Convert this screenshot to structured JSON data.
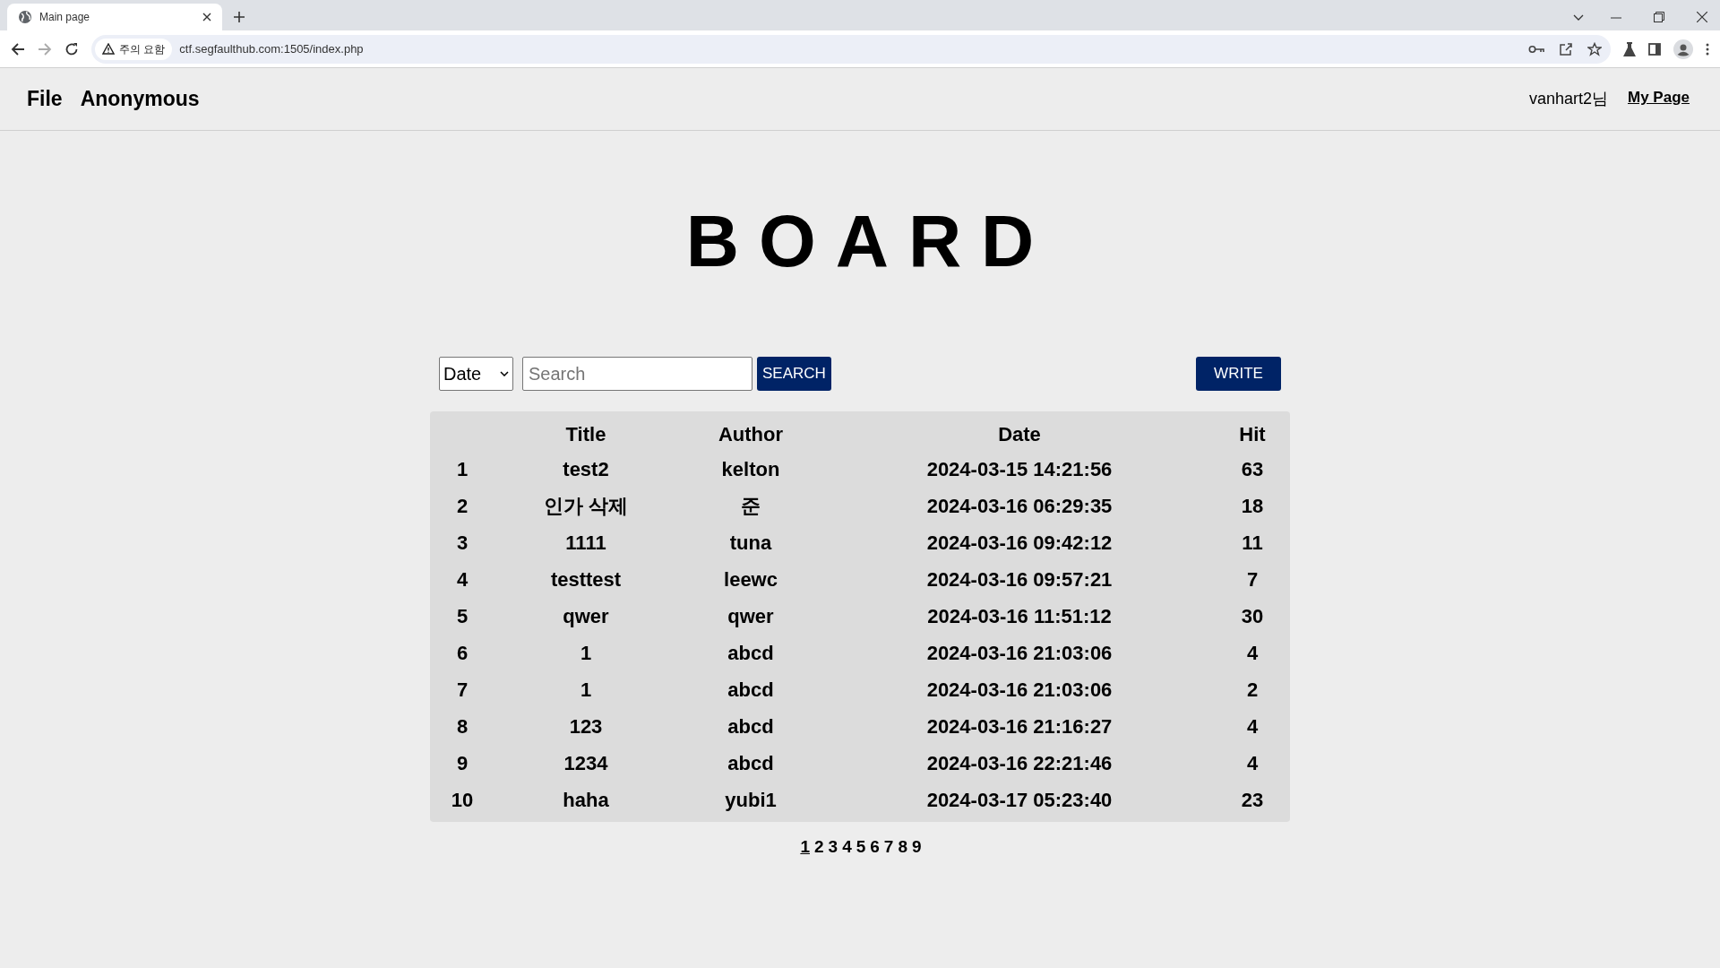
{
  "browser": {
    "tab": {
      "title": "Main page"
    },
    "security": "주의 요함",
    "url": "ctf.segfaulthub.com:1505/index.php"
  },
  "nav": {
    "links": [
      "File",
      "Anonymous"
    ],
    "user": "vanhart2님",
    "my_page": "My Page"
  },
  "heading": "BOARD",
  "search": {
    "filter": "Date",
    "placeholder": "Search",
    "button": "SEARCH",
    "write": "WRITE"
  },
  "table": {
    "columns": [
      "",
      "Title",
      "Author",
      "Date",
      "Hit"
    ],
    "rows": [
      [
        "1",
        "test2",
        "kelton",
        "2024-03-15 14:21:56",
        "63"
      ],
      [
        "2",
        "인가 삭제",
        "준",
        "2024-03-16 06:29:35",
        "18"
      ],
      [
        "3",
        "1111",
        "tuna",
        "2024-03-16 09:42:12",
        "11"
      ],
      [
        "4",
        "testtest",
        "leewc",
        "2024-03-16 09:57:21",
        "7"
      ],
      [
        "5",
        "qwer",
        "qwer",
        "2024-03-16 11:51:12",
        "30"
      ],
      [
        "6",
        "1",
        "abcd",
        "2024-03-16 21:03:06",
        "4"
      ],
      [
        "7",
        "1",
        "abcd",
        "2024-03-16 21:03:06",
        "2"
      ],
      [
        "8",
        "123",
        "abcd",
        "2024-03-16 21:16:27",
        "4"
      ],
      [
        "9",
        "1234",
        "abcd",
        "2024-03-16 22:21:46",
        "4"
      ],
      [
        "10",
        "haha",
        "yubi1",
        "2024-03-17 05:23:40",
        "23"
      ]
    ]
  },
  "pagination": [
    {
      "label": "1",
      "selected": true
    },
    {
      "label": "2",
      "selected": false
    },
    {
      "label": "3",
      "selected": false
    },
    {
      "label": "4",
      "selected": false
    },
    {
      "label": "5",
      "selected": false
    },
    {
      "label": "6",
      "selected": false
    },
    {
      "label": "7",
      "selected": false
    },
    {
      "label": "8",
      "selected": false
    },
    {
      "label": "9",
      "selected": false
    }
  ]
}
